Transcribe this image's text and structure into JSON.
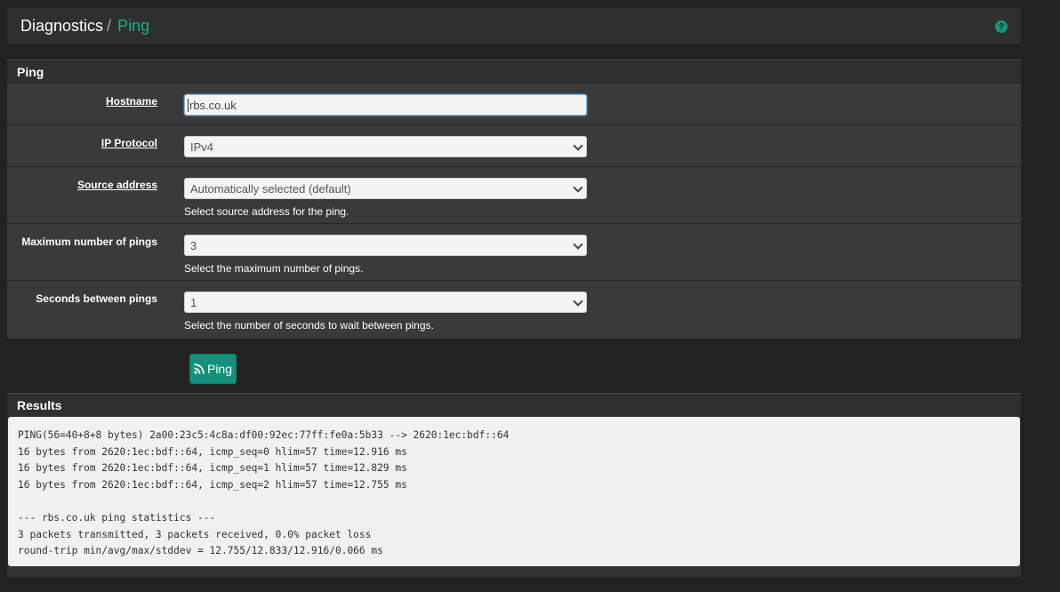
{
  "breadcrumb": {
    "section": "Diagnostics",
    "separator": "/",
    "current": "Ping"
  },
  "help_icon": "?",
  "ping_panel": {
    "title": "Ping",
    "hostname": {
      "label": "Hostname",
      "value": "rbs.co.uk"
    },
    "ip_protocol": {
      "label": "IP Protocol",
      "value": "IPv4"
    },
    "source_address": {
      "label": "Source address",
      "value": "Automatically selected (default)",
      "help": "Select source address for the ping."
    },
    "max_pings": {
      "label": "Maximum number of pings",
      "value": "3",
      "help": "Select the maximum number of pings."
    },
    "seconds_between": {
      "label": "Seconds between pings",
      "value": "1",
      "help": "Select the number of seconds to wait between pings."
    }
  },
  "ping_button": {
    "label": "Ping",
    "icon": "rss-icon"
  },
  "results": {
    "title": "Results",
    "lines": [
      "PING(56=40+8+8 bytes) 2a00:23c5:4c8a:df00:92ec:77ff:fe0a:5b33 --> 2620:1ec:bdf::64",
      "16 bytes from 2620:1ec:bdf::64, icmp_seq=0 hlim=57 time=12.916 ms",
      "16 bytes from 2620:1ec:bdf::64, icmp_seq=1 hlim=57 time=12.829 ms",
      "16 bytes from 2620:1ec:bdf::64, icmp_seq=2 hlim=57 time=12.755 ms",
      "",
      "--- rbs.co.uk ping statistics ---",
      "3 packets transmitted, 3 packets received, 0.0% packet loss",
      "round-trip min/avg/max/stddev = 12.755/12.833/12.916/0.066 ms"
    ]
  }
}
